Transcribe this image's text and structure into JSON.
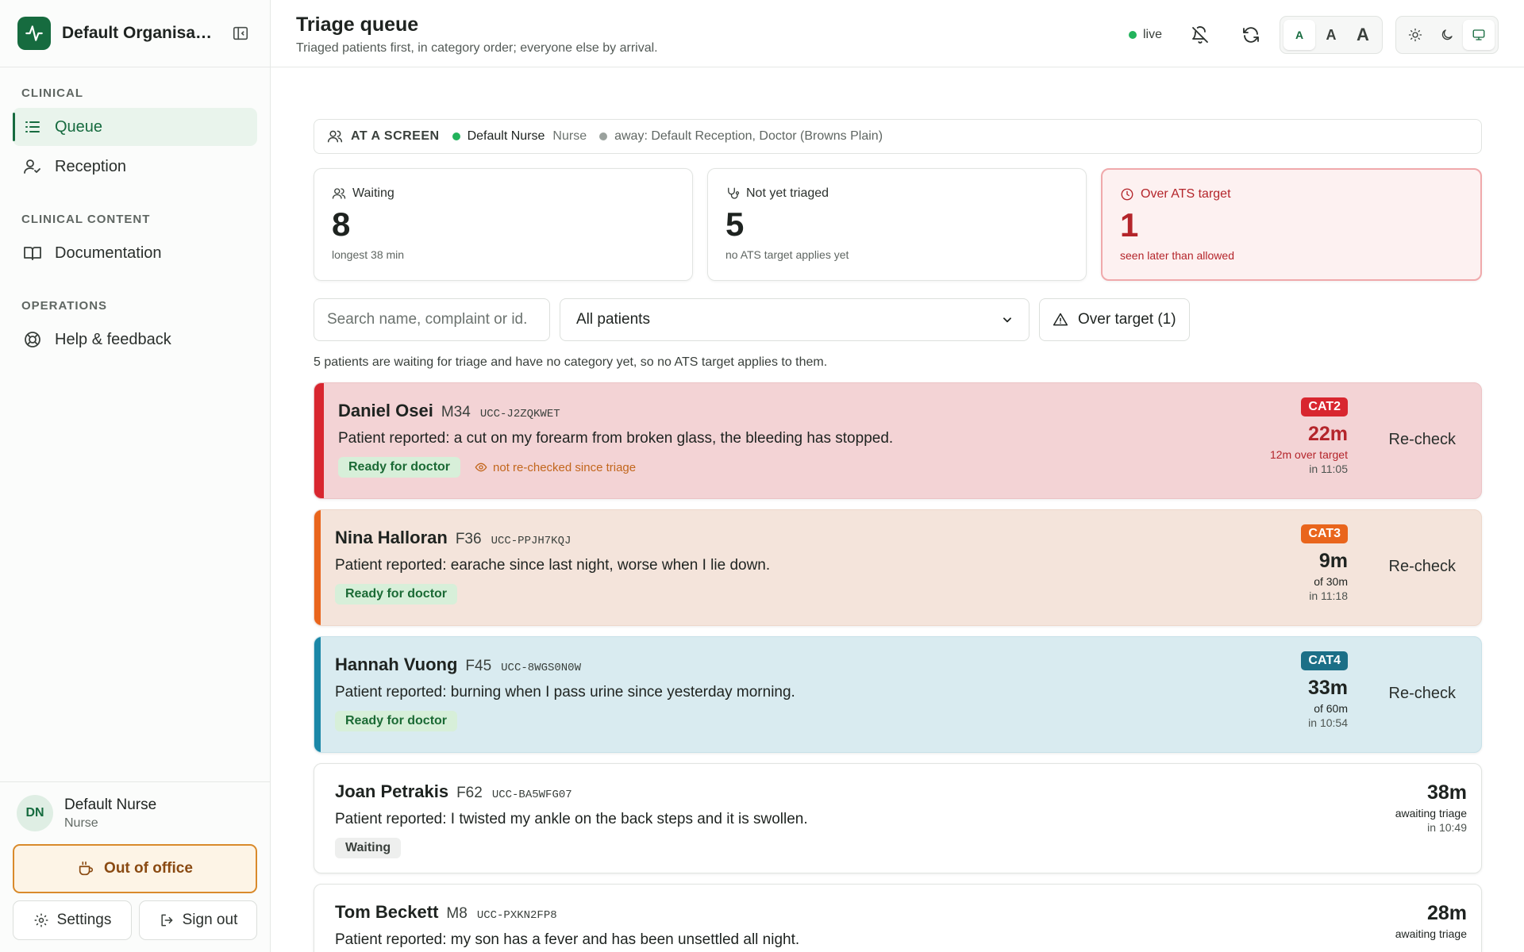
{
  "org": {
    "name": "Default Organisation"
  },
  "nav": {
    "sections": [
      {
        "heading": "CLINICAL",
        "items": [
          {
            "label": "Queue"
          },
          {
            "label": "Reception"
          }
        ]
      },
      {
        "heading": "CLINICAL CONTENT",
        "items": [
          {
            "label": "Documentation"
          }
        ]
      },
      {
        "heading": "OPERATIONS",
        "items": [
          {
            "label": "Help & feedback"
          }
        ]
      }
    ]
  },
  "user": {
    "initials": "DN",
    "name": "Default Nurse",
    "role": "Nurse"
  },
  "footer": {
    "out_of_office": "Out of office",
    "settings": "Settings",
    "sign_out": "Sign out"
  },
  "header": {
    "title": "Triage queue",
    "subtitle": "Triaged patients first, in category order; everyone else by arrival.",
    "live": "live",
    "text_sizes": [
      "A",
      "A",
      "A"
    ]
  },
  "screen": {
    "label": "AT A SCREEN",
    "present_name": "Default Nurse",
    "present_role": "Nurse",
    "away": "away: Default Reception, Doctor (Browns Plain)"
  },
  "stats": {
    "waiting": {
      "label": "Waiting",
      "value": "8",
      "sub": "longest 38 min"
    },
    "not_triaged": {
      "label": "Not yet triaged",
      "value": "5",
      "sub": "no ATS target applies yet"
    },
    "over_target": {
      "label": "Over ATS target",
      "value": "1",
      "sub": "seen later than allowed"
    }
  },
  "filters": {
    "search_placeholder": "Search name, complaint or id.",
    "select_value": "All patients",
    "over_target_btn": "Over target (1)"
  },
  "info_note": "5 patients are waiting for triage and have no category yet, so no ATS target applies to them.",
  "colors": {
    "brand": "#166b3f",
    "cat2": "#d8262f",
    "cat3": "#e9651c",
    "cat4": "#1b87a7"
  },
  "queue": [
    {
      "name": "Daniel Osei",
      "meta": "M34",
      "id": "UCC-J2ZQKWET",
      "complaint": "Patient reported: a cut on my forearm from broken glass, the bleeding has stopped.",
      "status": "Ready for doctor",
      "warning": "not re-checked since triage",
      "category": "CAT2",
      "elapsed": "22m",
      "target": "12m over target",
      "eta": "in 11:05",
      "action": "Re-check"
    },
    {
      "name": "Nina Halloran",
      "meta": "F36",
      "id": "UCC-PPJH7KQJ",
      "complaint": "Patient reported: earache since last night, worse when I lie down.",
      "status": "Ready for doctor",
      "category": "CAT3",
      "elapsed": "9m",
      "target": "of 30m",
      "eta": "in 11:18",
      "action": "Re-check"
    },
    {
      "name": "Hannah Vuong",
      "meta": "F45",
      "id": "UCC-8WGS0N0W",
      "complaint": "Patient reported: burning when I pass urine since yesterday morning.",
      "status": "Ready for doctor",
      "category": "CAT4",
      "elapsed": "33m",
      "target": "of 60m",
      "eta": "in 10:54",
      "action": "Re-check"
    },
    {
      "name": "Joan Petrakis",
      "meta": "F62",
      "id": "UCC-BA5WFG07",
      "complaint": "Patient reported: I twisted my ankle on the back steps and it is swollen.",
      "status": "Waiting",
      "elapsed": "38m",
      "target": "awaiting triage",
      "eta": "in 10:49"
    },
    {
      "name": "Tom Beckett",
      "meta": "M8",
      "id": "UCC-PXKN2FP8",
      "complaint": "Patient reported: my son has a fever and has been unsettled all night.",
      "elapsed": "28m",
      "target": "awaiting triage"
    }
  ]
}
